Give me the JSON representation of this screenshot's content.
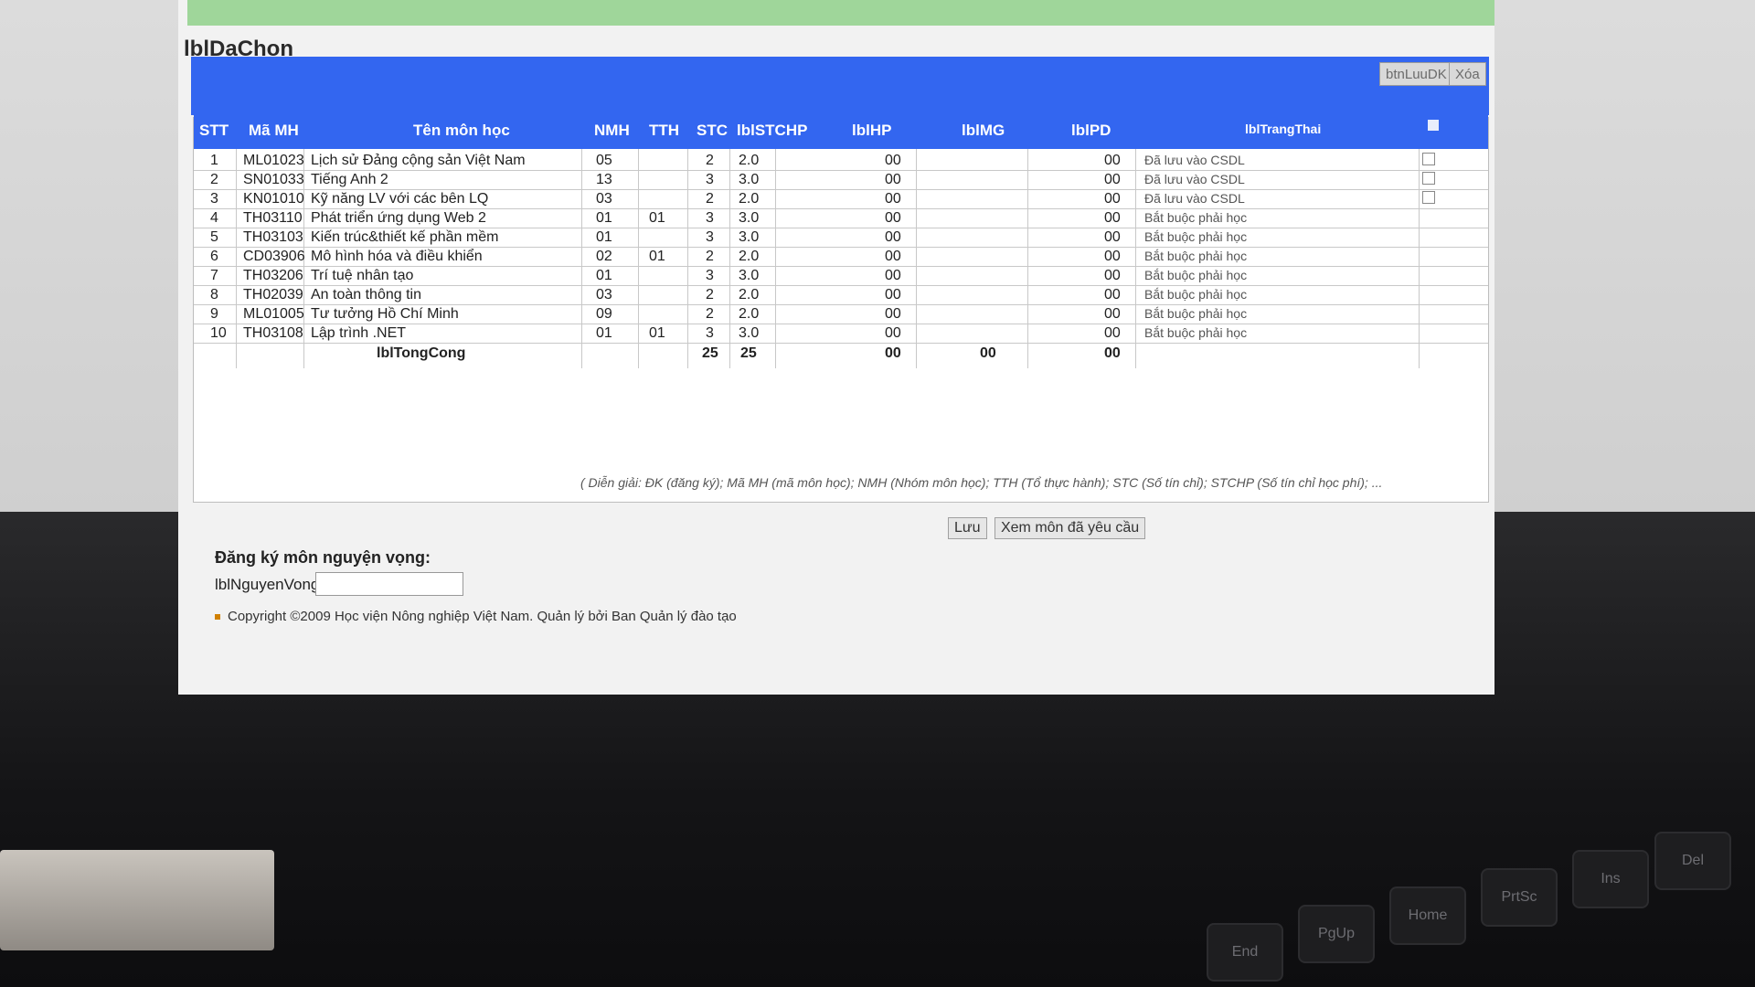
{
  "section_title": "lblDaChon",
  "buttons": {
    "save_reg": "btnLuuDK",
    "delete": "Xóa",
    "save": "Lưu",
    "view_requested": "Xem môn đã yêu cầu"
  },
  "table": {
    "headers": [
      "STT",
      "Mã MH",
      "Tên môn học",
      "NMH",
      "TTH",
      "STC",
      "lblSTCHP",
      "lblHP",
      "lblMG",
      "lblPD",
      "lblTrangThai"
    ],
    "rows": [
      {
        "stt": "1",
        "code": "ML01023",
        "name": "Lịch sử Đảng cộng sản Việt Nam",
        "nmh": "05",
        "tth": "",
        "stc": "2",
        "stchp": "2.0",
        "hp": "00",
        "mg": "",
        "pd": "00",
        "status": "Đã lưu vào CSDL"
      },
      {
        "stt": "2",
        "code": "SN01033",
        "name": "Tiếng Anh 2",
        "nmh": "13",
        "tth": "",
        "stc": "3",
        "stchp": "3.0",
        "hp": "00",
        "mg": "",
        "pd": "00",
        "status": "Đã lưu vào CSDL"
      },
      {
        "stt": "3",
        "code": "KN01010",
        "name": "Kỹ năng LV với các bên LQ",
        "nmh": "03",
        "tth": "",
        "stc": "2",
        "stchp": "2.0",
        "hp": "00",
        "mg": "",
        "pd": "00",
        "status": "Đã lưu vào CSDL"
      },
      {
        "stt": "4",
        "code": "TH03110",
        "name": "Phát triển ứng dụng Web 2",
        "nmh": "01",
        "tth": "01",
        "stc": "3",
        "stchp": "3.0",
        "hp": "00",
        "mg": "",
        "pd": "00",
        "status": "Bắt buộc phải học"
      },
      {
        "stt": "5",
        "code": "TH03103",
        "name": "Kiến trúc&thiết kế phần mềm",
        "nmh": "01",
        "tth": "",
        "stc": "3",
        "stchp": "3.0",
        "hp": "00",
        "mg": "",
        "pd": "00",
        "status": "Bắt buộc phải học"
      },
      {
        "stt": "6",
        "code": "CD03906",
        "name": "Mô hình hóa và điều khiển",
        "nmh": "02",
        "tth": "01",
        "stc": "2",
        "stchp": "2.0",
        "hp": "00",
        "mg": "",
        "pd": "00",
        "status": "Bắt buộc phải học"
      },
      {
        "stt": "7",
        "code": "TH03206",
        "name": "Trí tuệ nhân tạo",
        "nmh": "01",
        "tth": "",
        "stc": "3",
        "stchp": "3.0",
        "hp": "00",
        "mg": "",
        "pd": "00",
        "status": "Bắt buộc phải học"
      },
      {
        "stt": "8",
        "code": "TH02039",
        "name": "An toàn thông tin",
        "nmh": "03",
        "tth": "",
        "stc": "2",
        "stchp": "2.0",
        "hp": "00",
        "mg": "",
        "pd": "00",
        "status": "Bắt buộc phải học"
      },
      {
        "stt": "9",
        "code": "ML01005",
        "name": "Tư tưởng Hồ Chí Minh",
        "nmh": "09",
        "tth": "",
        "stc": "2",
        "stchp": "2.0",
        "hp": "00",
        "mg": "",
        "pd": "00",
        "status": "Bắt buộc phải học"
      },
      {
        "stt": "10",
        "code": "TH03108",
        "name": "Lập trình .NET",
        "nmh": "01",
        "tth": "01",
        "stc": "3",
        "stchp": "3.0",
        "hp": "00",
        "mg": "",
        "pd": "00",
        "status": "Bắt buộc phải học"
      }
    ],
    "total": {
      "label": "lblTongCong",
      "stc": "25",
      "stchp": "25",
      "hp": "00",
      "mg": "00",
      "pd": "00"
    }
  },
  "legend": "( Diễn giải: ĐK (đăng ký); Mã MH (mã môn học); NMH (Nhóm môn học); TTH (Tổ thực hành); STC (Số tín chỉ); STCHP (Số tín chỉ học phí); ...",
  "registration": {
    "title": "Đăng ký môn nguyện vọng:",
    "label": "lblNguyenVong"
  },
  "footer": "Copyright ©2009 Học viện Nông nghiệp Việt Nam. Quản lý bởi Ban Quản lý đào tạo",
  "keys": [
    "End",
    "PgUp",
    "Home",
    "PrtSc",
    "Ins",
    "Del"
  ]
}
